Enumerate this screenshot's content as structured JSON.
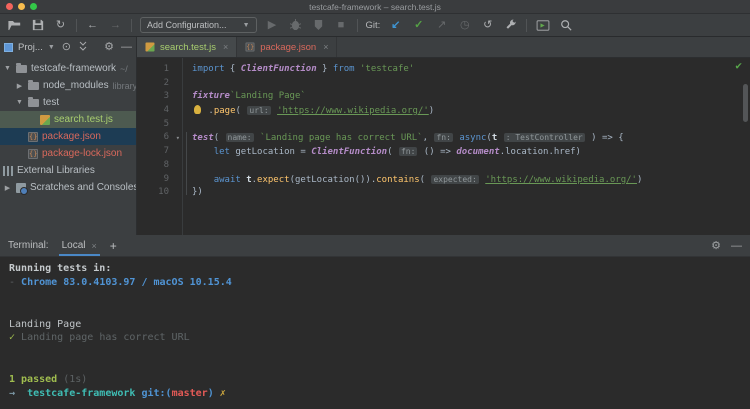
{
  "window": {
    "title": "testcafe-framework – search.test.js"
  },
  "toolbar": {
    "run_config": "Add Configuration...",
    "git_label": "Git:"
  },
  "project": {
    "title": "Proj...",
    "items": [
      {
        "label": "testcafe-framework",
        "suffix": " ~/",
        "icon": "folder",
        "arrow": "▼",
        "indent": 0,
        "color": "normal",
        "row": ""
      },
      {
        "label": "node_modules",
        "suffix": " library",
        "icon": "folder",
        "arrow": "▶",
        "indent": 1,
        "color": "normal",
        "row": ""
      },
      {
        "label": "test",
        "suffix": "",
        "icon": "folder",
        "arrow": "▼",
        "indent": 1,
        "color": "normal",
        "row": ""
      },
      {
        "label": "search.test.js",
        "suffix": "",
        "icon": "js-test",
        "arrow": "",
        "slot": true,
        "indent": 2,
        "color": "green",
        "row": "olive"
      },
      {
        "label": "package.json",
        "suffix": "",
        "icon": "json",
        "arrow": "",
        "slot": true,
        "indent": 1,
        "color": "red",
        "row": "navy"
      },
      {
        "label": "package-lock.json",
        "suffix": "",
        "icon": "json",
        "arrow": "",
        "slot": true,
        "indent": 1,
        "color": "red",
        "row": ""
      },
      {
        "label": "External Libraries",
        "suffix": "",
        "icon": "libraries",
        "arrow": "",
        "slot": false,
        "indent": 0,
        "color": "normal",
        "row": ""
      },
      {
        "label": "Scratches and Consoles",
        "suffix": "",
        "icon": "scratches",
        "arrow": "▶",
        "indent": 0,
        "color": "normal",
        "row": ""
      }
    ]
  },
  "editor": {
    "tabs": [
      {
        "label": "search.test.js",
        "icon": "js-test",
        "color": "green",
        "close": "×"
      },
      {
        "label": "package.json",
        "icon": "json",
        "color": "red",
        "close": "×"
      }
    ],
    "lines": [
      [
        {
          "c": "kw",
          "t": "import"
        },
        {
          "c": "pl",
          "t": " { "
        },
        {
          "c": "fn",
          "t": "ClientFunction"
        },
        {
          "c": "pl",
          "t": " } "
        },
        {
          "c": "kw",
          "t": "from"
        },
        {
          "c": "pl",
          "t": " "
        },
        {
          "c": "str",
          "t": "'testcafe'"
        }
      ],
      [],
      [
        {
          "c": "fn",
          "t": "fixture"
        },
        {
          "c": "str",
          "t": "`Landing Page`"
        }
      ],
      [
        {
          "c": "bulb",
          "t": ""
        },
        {
          "c": "pl",
          "t": " ."
        },
        {
          "c": "call",
          "t": "page"
        },
        {
          "c": "pl",
          "t": "( "
        },
        {
          "c": "hint",
          "t": "url:"
        },
        {
          "c": "pl",
          "t": " "
        },
        {
          "c": "strl",
          "t": "'https://www.wikipedia.org/'"
        },
        {
          "c": "pl",
          "t": ")"
        }
      ],
      [],
      [
        {
          "c": "fn",
          "t": "test"
        },
        {
          "c": "pl",
          "t": "( "
        },
        {
          "c": "hint",
          "t": "name:"
        },
        {
          "c": "pl",
          "t": " "
        },
        {
          "c": "str",
          "t": "`Landing page has correct URL`"
        },
        {
          "c": "pl",
          "t": ", "
        },
        {
          "c": "hint",
          "t": "fn:"
        },
        {
          "c": "pl",
          "t": " "
        },
        {
          "c": "kw",
          "t": "async"
        },
        {
          "c": "pl",
          "t": "("
        },
        {
          "c": "bold",
          "t": "t"
        },
        {
          "c": "pl",
          "t": " "
        },
        {
          "c": "hint",
          "t": ": TestController"
        },
        {
          "c": "pl",
          "t": " ) => {"
        }
      ],
      [
        {
          "c": "pl",
          "t": "    "
        },
        {
          "c": "kw",
          "t": "let"
        },
        {
          "c": "pl",
          "t": " getLocation = "
        },
        {
          "c": "fn",
          "t": "ClientFunction"
        },
        {
          "c": "pl",
          "t": "( "
        },
        {
          "c": "hint",
          "t": "fn:"
        },
        {
          "c": "pl",
          "t": " () => "
        },
        {
          "c": "fn",
          "t": "document"
        },
        {
          "c": "pl",
          "t": ".location.href)"
        }
      ],
      [],
      [
        {
          "c": "pl",
          "t": "    "
        },
        {
          "c": "kw",
          "t": "await"
        },
        {
          "c": "pl",
          "t": " "
        },
        {
          "c": "bold",
          "t": "t"
        },
        {
          "c": "pl",
          "t": "."
        },
        {
          "c": "call",
          "t": "expect"
        },
        {
          "c": "pl",
          "t": "(getLocation())."
        },
        {
          "c": "call",
          "t": "contains"
        },
        {
          "c": "pl",
          "t": "( "
        },
        {
          "c": "hint",
          "t": "expected:"
        },
        {
          "c": "pl",
          "t": " "
        },
        {
          "c": "strl",
          "t": "'https://www.wikipedia.org/'"
        },
        {
          "c": "pl",
          "t": ")"
        }
      ],
      [
        {
          "c": "pl",
          "t": "})"
        }
      ]
    ]
  },
  "terminal": {
    "label": "Terminal:",
    "tab": "Local",
    "lines": [
      [
        {
          "c": "wb",
          "t": "Running tests in:"
        }
      ],
      [
        {
          "c": "dim",
          "t": "- "
        },
        {
          "c": "blue",
          "t": "Chrome 83.0.4103.97 / macOS 10.15.4"
        }
      ],
      [],
      [],
      [
        {
          "c": "w",
          "t": "Landing Page"
        }
      ],
      [
        {
          "c": "grn",
          "t": "✓ "
        },
        {
          "c": "mut",
          "t": "Landing page has correct URL"
        }
      ],
      [],
      [],
      [
        {
          "c": "grnb",
          "t": "1 passed"
        },
        {
          "c": "dim",
          "t": " (1s)"
        }
      ],
      [
        {
          "c": "arr",
          "t": "→  "
        },
        {
          "c": "teal",
          "t": "testcafe-framework "
        },
        {
          "c": "gblue",
          "t": "git:("
        },
        {
          "c": "red",
          "t": "master"
        },
        {
          "c": "gblue",
          "t": ") "
        },
        {
          "c": "yel",
          "t": "✗"
        }
      ]
    ]
  }
}
